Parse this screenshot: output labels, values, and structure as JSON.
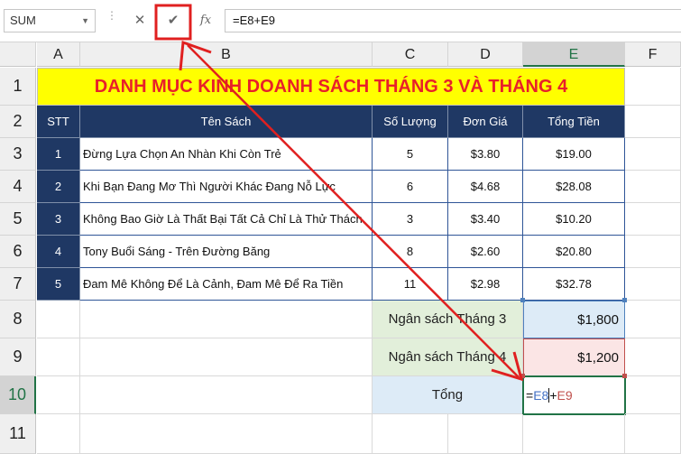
{
  "formula_bar": {
    "name_box": "SUM",
    "cancel_icon": "x-icon",
    "enter_icon": "checkmark-icon",
    "function_icon": "fx-icon",
    "fx_label": "fx",
    "formula": "=E8+E9"
  },
  "columns": [
    "A",
    "B",
    "C",
    "D",
    "E",
    "F"
  ],
  "rows": [
    "1",
    "2",
    "3",
    "4",
    "5",
    "6",
    "7",
    "8",
    "9",
    "10",
    "11"
  ],
  "sheet": {
    "title": "DANH MỤC KINH DOANH SÁCH THÁNG 3 VÀ THÁNG 4",
    "headers": [
      "STT",
      "Tên Sách",
      "Số Lượng",
      "Đơn Giá",
      "Tổng Tiền"
    ],
    "books": [
      {
        "stt": "1",
        "name": "Đừng Lựa Chọn An Nhàn Khi Còn Trẻ",
        "qty": "5",
        "price": "$3.80",
        "total": "$19.00"
      },
      {
        "stt": "2",
        "name": "Khi Bạn Đang Mơ Thì Người Khác Đang Nỗ Lực",
        "qty": "6",
        "price": "$4.68",
        "total": "$28.08"
      },
      {
        "stt": "3",
        "name": "Không Bao Giờ Là Thất Bại Tất Cả Chỉ Là Thử Thách",
        "qty": "3",
        "price": "$3.40",
        "total": "$10.20"
      },
      {
        "stt": "4",
        "name": "Tony Buổi Sáng - Trên Đường Băng",
        "qty": "8",
        "price": "$2.60",
        "total": "$20.80"
      },
      {
        "stt": "5",
        "name": "Đam Mê Không Để Là Cảnh, Đam Mê Để Ra Tiền",
        "qty": "11",
        "price": "$2.98",
        "total": "$32.78"
      }
    ],
    "budget_march_label": "Ngân sách Tháng 3",
    "budget_march_value": "$1,800",
    "budget_april_label": "Ngân sách Tháng 4",
    "budget_april_value": "$1,200",
    "total_label": "Tổng",
    "edit_eq": "=",
    "edit_ref1": "E8",
    "edit_plus": "+",
    "edit_ref2": "E9"
  },
  "colors": {
    "header_bg": "#1f3864",
    "title_bg": "#ffff00",
    "title_text": "#e8202a",
    "annotation": "#e02020",
    "active_border": "#217346"
  }
}
